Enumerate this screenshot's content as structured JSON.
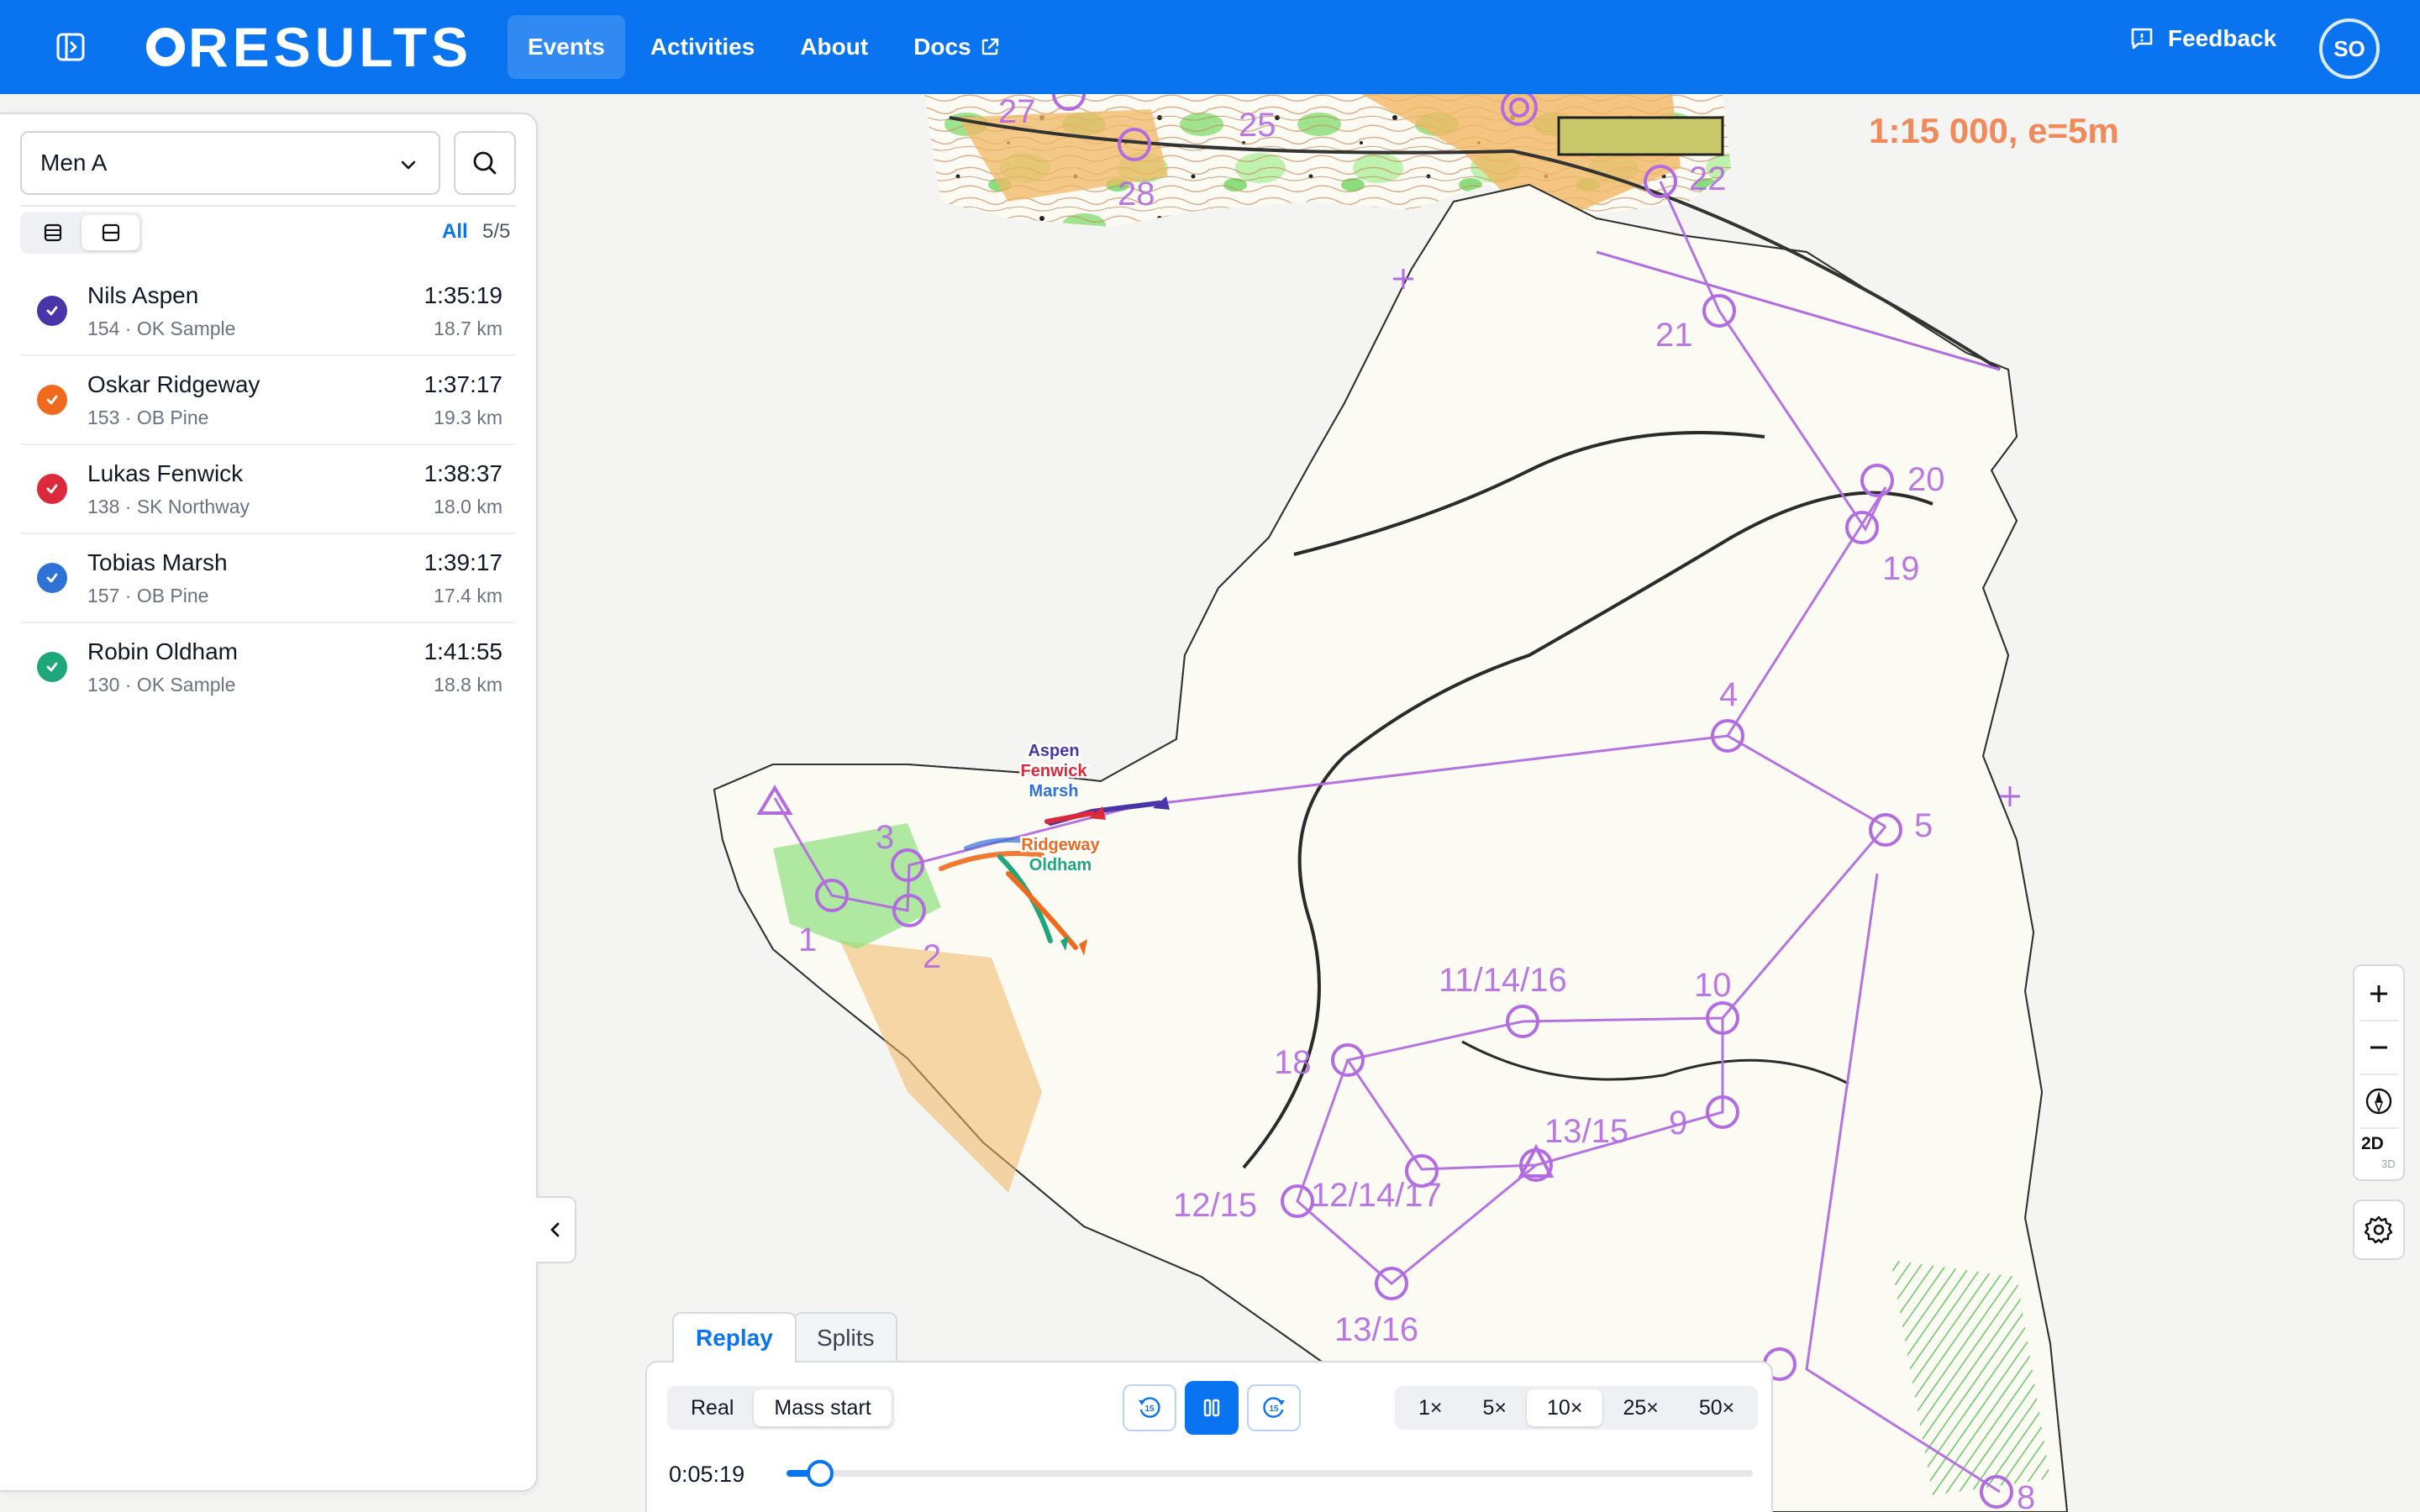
{
  "app": {
    "logo_text": "RESULTS",
    "nav": [
      {
        "label": "Events",
        "active": true
      },
      {
        "label": "Activities",
        "active": false
      },
      {
        "label": "About",
        "active": false
      },
      {
        "label": "Docs",
        "active": false,
        "external": true
      }
    ],
    "feedback_label": "Feedback",
    "avatar_initials": "SO",
    "accent_color": "#0a74f0"
  },
  "panel": {
    "class_select": "Men A",
    "filter_all": "All",
    "filter_count": "5/5",
    "runners": [
      {
        "name": "Nils Aspen",
        "club": "154 · OK Sample",
        "time": "1:35:19",
        "distance": "18.7 km",
        "color": "#4a35a8"
      },
      {
        "name": "Oskar Ridgeway",
        "club": "153 · OB Pine",
        "time": "1:37:17",
        "distance": "19.3 km",
        "color": "#f06a1d"
      },
      {
        "name": "Lukas Fenwick",
        "club": "138 · SK Northway",
        "time": "1:38:37",
        "distance": "18.0 km",
        "color": "#dc2a3c"
      },
      {
        "name": "Tobias Marsh",
        "club": "157 · OB Pine",
        "time": "1:39:17",
        "distance": "17.4 km",
        "color": "#2f72d6"
      },
      {
        "name": "Robin Oldham",
        "club": "130 · OK Sample",
        "time": "1:41:55",
        "distance": "18.8 km",
        "color": "#1ea77a"
      }
    ]
  },
  "map": {
    "scale_text": "1:15 000, e=5m",
    "controls": [
      "27",
      "25",
      "28",
      "22",
      "21",
      "20",
      "19",
      "4",
      "5",
      "3",
      "1",
      "2",
      "10",
      "11/14/16",
      "18",
      "9",
      "13/15",
      "12/14/17",
      "12/15",
      "13/16",
      "8"
    ],
    "runner_labels": [
      "Aspen",
      "Fenwick",
      "Marsh",
      "Ridgeway",
      "Oldham"
    ],
    "control_color": "#b26ce0"
  },
  "map_controls": {
    "dim_2d": "2D",
    "dim_3d": "3D"
  },
  "replay": {
    "tabs": [
      "Replay",
      "Splits"
    ],
    "active_tab": "Replay",
    "start_modes": [
      "Real",
      "Mass start"
    ],
    "active_start_mode": "Mass start",
    "speeds": [
      "1×",
      "5×",
      "10×",
      "25×",
      "50×"
    ],
    "active_speed": "10×",
    "current_time": "0:05:19",
    "progress": 0.035
  }
}
